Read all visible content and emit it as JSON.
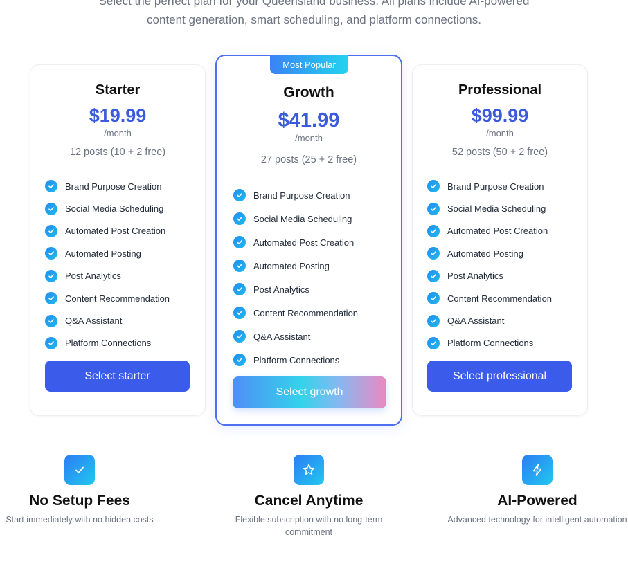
{
  "intro": {
    "line1": "Select the perfect plan for your Queensland business. All plans include AI-powered",
    "line2": "content generation, smart scheduling, and platform connections."
  },
  "plans": [
    {
      "name": "Starter",
      "price": "$19.99",
      "period": "/month",
      "posts": "12 posts (10 + 2 free)",
      "features": [
        "Brand Purpose Creation",
        "Social Media Scheduling",
        "Automated Post Creation",
        "Automated Posting",
        "Post Analytics",
        "Content Recommendation",
        "Q&A Assistant",
        "Platform Connections"
      ],
      "button": "Select starter"
    },
    {
      "badge": "Most Popular",
      "name": "Growth",
      "price": "$41.99",
      "period": "/month",
      "posts": "27 posts (25 + 2 free)",
      "features": [
        "Brand Purpose Creation",
        "Social Media Scheduling",
        "Automated Post Creation",
        "Automated Posting",
        "Post Analytics",
        "Content Recommendation",
        "Q&A Assistant",
        "Platform Connections"
      ],
      "button": "Select growth"
    },
    {
      "name": "Professional",
      "price": "$99.99",
      "period": "/month",
      "posts": "52 posts (50 + 2 free)",
      "features": [
        "Brand Purpose Creation",
        "Social Media Scheduling",
        "Automated Post Creation",
        "Automated Posting",
        "Post Analytics",
        "Content Recommendation",
        "Q&A Assistant",
        "Platform Connections"
      ],
      "button": "Select professional"
    }
  ],
  "perks": [
    {
      "icon": "check-icon",
      "title": "No Setup Fees",
      "description": "Start immediately with no hidden costs"
    },
    {
      "icon": "star-icon",
      "title": "Cancel Anytime",
      "description": "Flexible subscription with no long-term commitment"
    },
    {
      "icon": "lightning-icon",
      "title": "AI-Powered",
      "description": "Advanced technology for intelligent automation"
    }
  ],
  "colors": {
    "accent": "#3b5bea",
    "price": "#3b5bdb",
    "featured_border": "#4f6ef0",
    "check": "#1f8ef1"
  }
}
